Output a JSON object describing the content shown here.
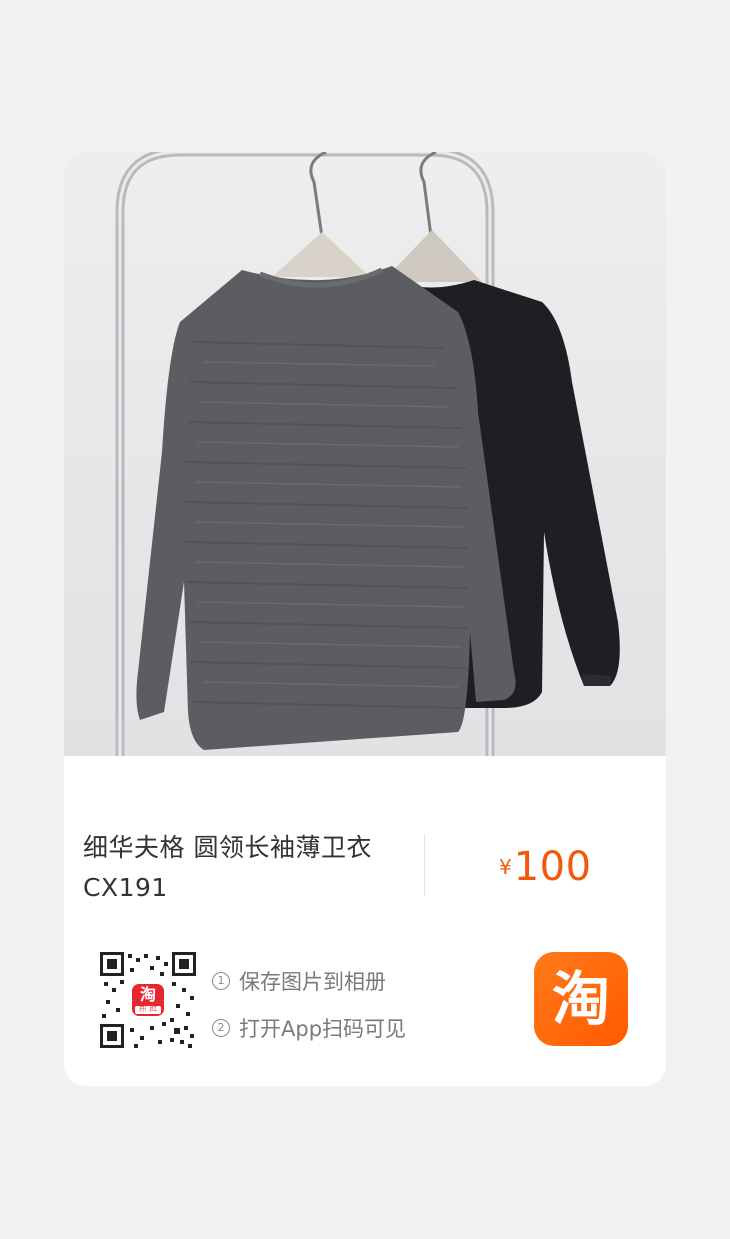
{
  "product": {
    "title_line1": "细华夫格 圆领长袖薄卫衣",
    "title_line2": "CX191",
    "currency": "¥",
    "price": "100"
  },
  "share": {
    "step1_num": "1",
    "step1": "保存图片到相册",
    "step2_num": "2",
    "step2": "打开App扫码可见"
  },
  "qr_logo": {
    "glyph": "淘",
    "sub": "开门红"
  },
  "app_icon": {
    "glyph": "淘",
    "icon": "taobao-app-icon"
  },
  "colors": {
    "price": "#f05a0a",
    "app_orange": "#ff6a00",
    "qr_red": "#e8262d"
  }
}
